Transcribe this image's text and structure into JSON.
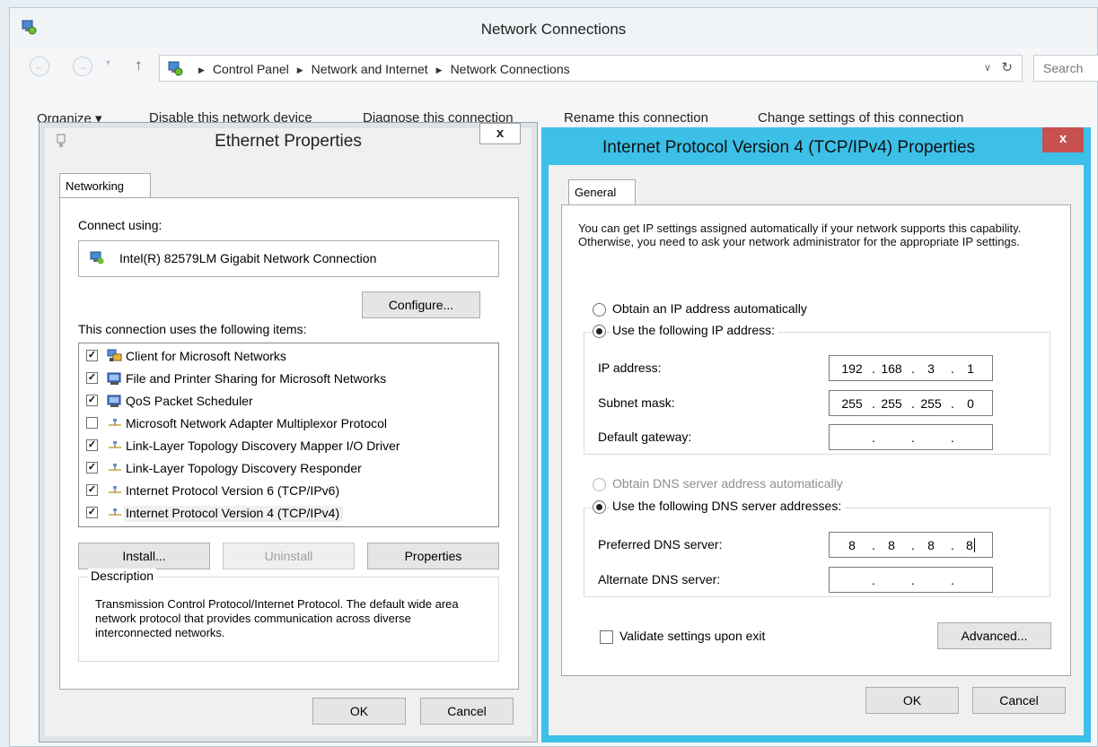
{
  "explorer": {
    "title": "Network Connections",
    "breadcrumbs": [
      "Control Panel",
      "Network and Internet",
      "Network Connections"
    ],
    "search_placeholder": "Search",
    "toolbar": [
      "Organize ▾",
      "Disable this network device",
      "Diagnose this connection",
      "Rename this connection",
      "Change settings of this connection"
    ]
  },
  "ethernet": {
    "title": "Ethernet Properties",
    "close": "x",
    "tab": "Networking",
    "connect_using_label": "Connect using:",
    "adapter": "Intel(R) 82579LM Gigabit Network Connection",
    "configure": "Configure...",
    "items_label": "This connection uses the following items:",
    "items": [
      {
        "label": "Client for Microsoft Networks",
        "checked": true,
        "icon": "network-client-icon"
      },
      {
        "label": "File and Printer Sharing for Microsoft Networks",
        "checked": true,
        "icon": "service-icon"
      },
      {
        "label": "QoS Packet Scheduler",
        "checked": true,
        "icon": "service-icon"
      },
      {
        "label": "Microsoft Network Adapter Multiplexor Protocol",
        "checked": false,
        "icon": "protocol-icon"
      },
      {
        "label": "Link-Layer Topology Discovery Mapper I/O Driver",
        "checked": true,
        "icon": "protocol-icon"
      },
      {
        "label": "Link-Layer Topology Discovery Responder",
        "checked": true,
        "icon": "protocol-icon"
      },
      {
        "label": "Internet Protocol Version 6 (TCP/IPv6)",
        "checked": true,
        "icon": "protocol-icon"
      },
      {
        "label": "Internet Protocol Version 4 (TCP/IPv4)",
        "checked": true,
        "icon": "protocol-icon",
        "selected": true
      }
    ],
    "install": "Install...",
    "uninstall": "Uninstall",
    "properties": "Properties",
    "description_label": "Description",
    "description": "Transmission Control Protocol/Internet Protocol. The default wide area network protocol that provides communication across diverse interconnected networks.",
    "ok": "OK",
    "cancel": "Cancel"
  },
  "ipv4": {
    "title": "Internet Protocol Version 4 (TCP/IPv4) Properties",
    "close": "x",
    "tab": "General",
    "intro": "You can get IP settings assigned automatically if your network supports this capability. Otherwise, you need to ask your network administrator for the appropriate IP settings.",
    "obtain_ip_auto": "Obtain an IP address automatically",
    "use_following_ip": "Use the following IP address:",
    "ip_mode": "manual",
    "ip_address_label": "IP address:",
    "ip_address": [
      "192",
      "168",
      "3",
      "1"
    ],
    "subnet_label": "Subnet mask:",
    "subnet": [
      "255",
      "255",
      "255",
      "0"
    ],
    "gateway_label": "Default gateway:",
    "gateway": [
      "",
      "",
      "",
      ""
    ],
    "obtain_dns_auto": "Obtain DNS server address automatically",
    "use_following_dns": "Use the following DNS server addresses:",
    "dns_mode": "manual",
    "preferred_dns_label": "Preferred DNS server:",
    "preferred_dns": [
      "8",
      "8",
      "8",
      "8"
    ],
    "alternate_dns_label": "Alternate DNS server:",
    "alternate_dns": [
      "",
      "",
      "",
      ""
    ],
    "validate_label": "Validate settings upon exit",
    "validate_checked": false,
    "advanced": "Advanced...",
    "ok": "OK",
    "cancel": "Cancel"
  },
  "colors": {
    "ipv4_frame": "#3cc0e8",
    "close_red": "#c75050"
  }
}
